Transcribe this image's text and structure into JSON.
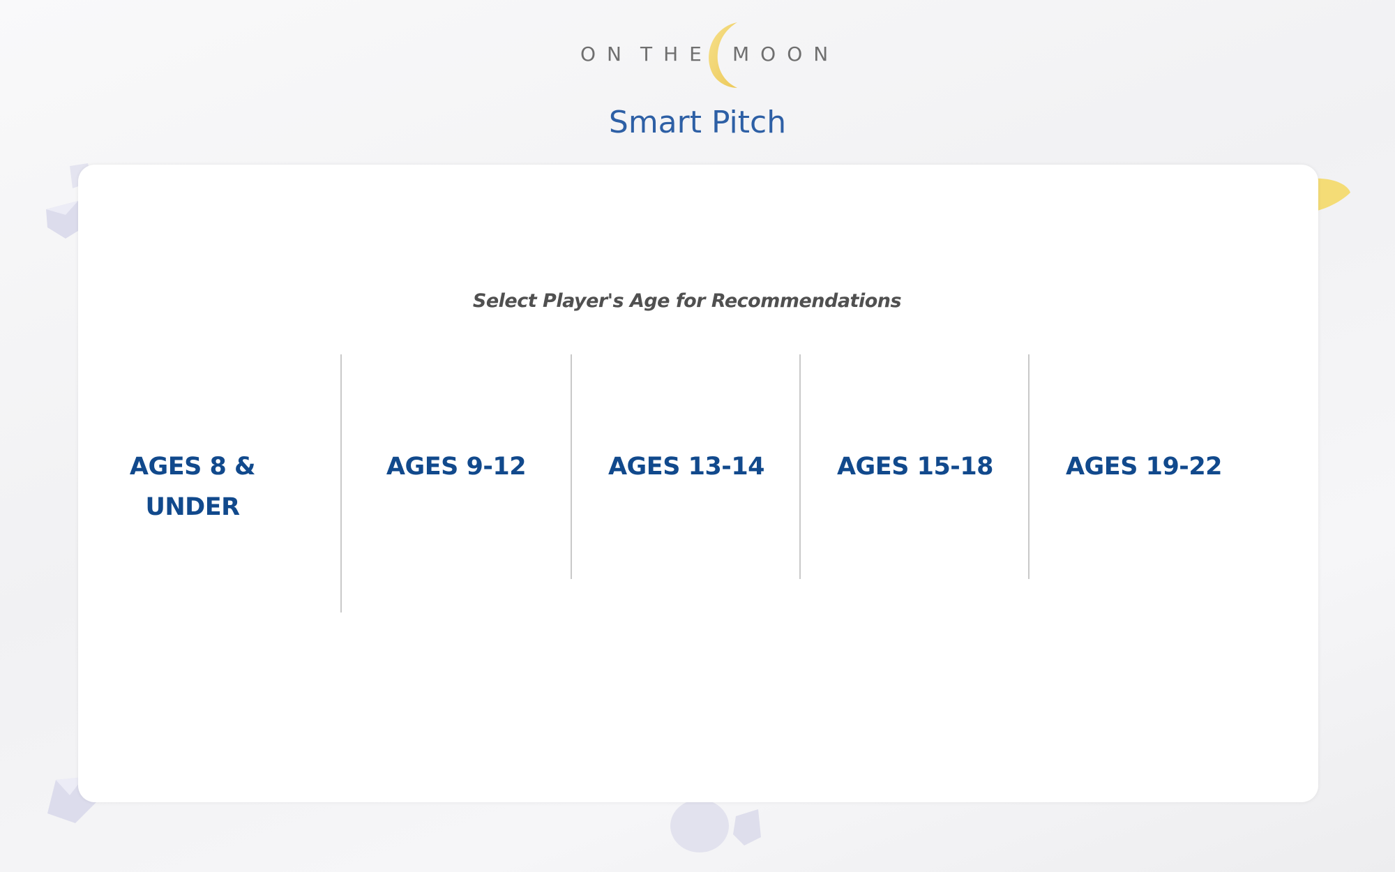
{
  "brand": {
    "logo_words": [
      "ON",
      "THE",
      "MOON"
    ],
    "accent_moon": "#f1d66a"
  },
  "app": {
    "title": "Smart Pitch"
  },
  "age_selector": {
    "prompt": "Select Player's Age for Recommendations",
    "options": [
      {
        "label": "AGES 8 & UNDER"
      },
      {
        "label": "AGES 9-12"
      },
      {
        "label": "AGES 13-14"
      },
      {
        "label": "AGES 15-18"
      },
      {
        "label": "AGES 19-22"
      }
    ]
  },
  "colors": {
    "title": "#2d5fa5",
    "option_text": "#11498c",
    "prompt_text": "#505050",
    "divider": "#c9c9c9"
  }
}
